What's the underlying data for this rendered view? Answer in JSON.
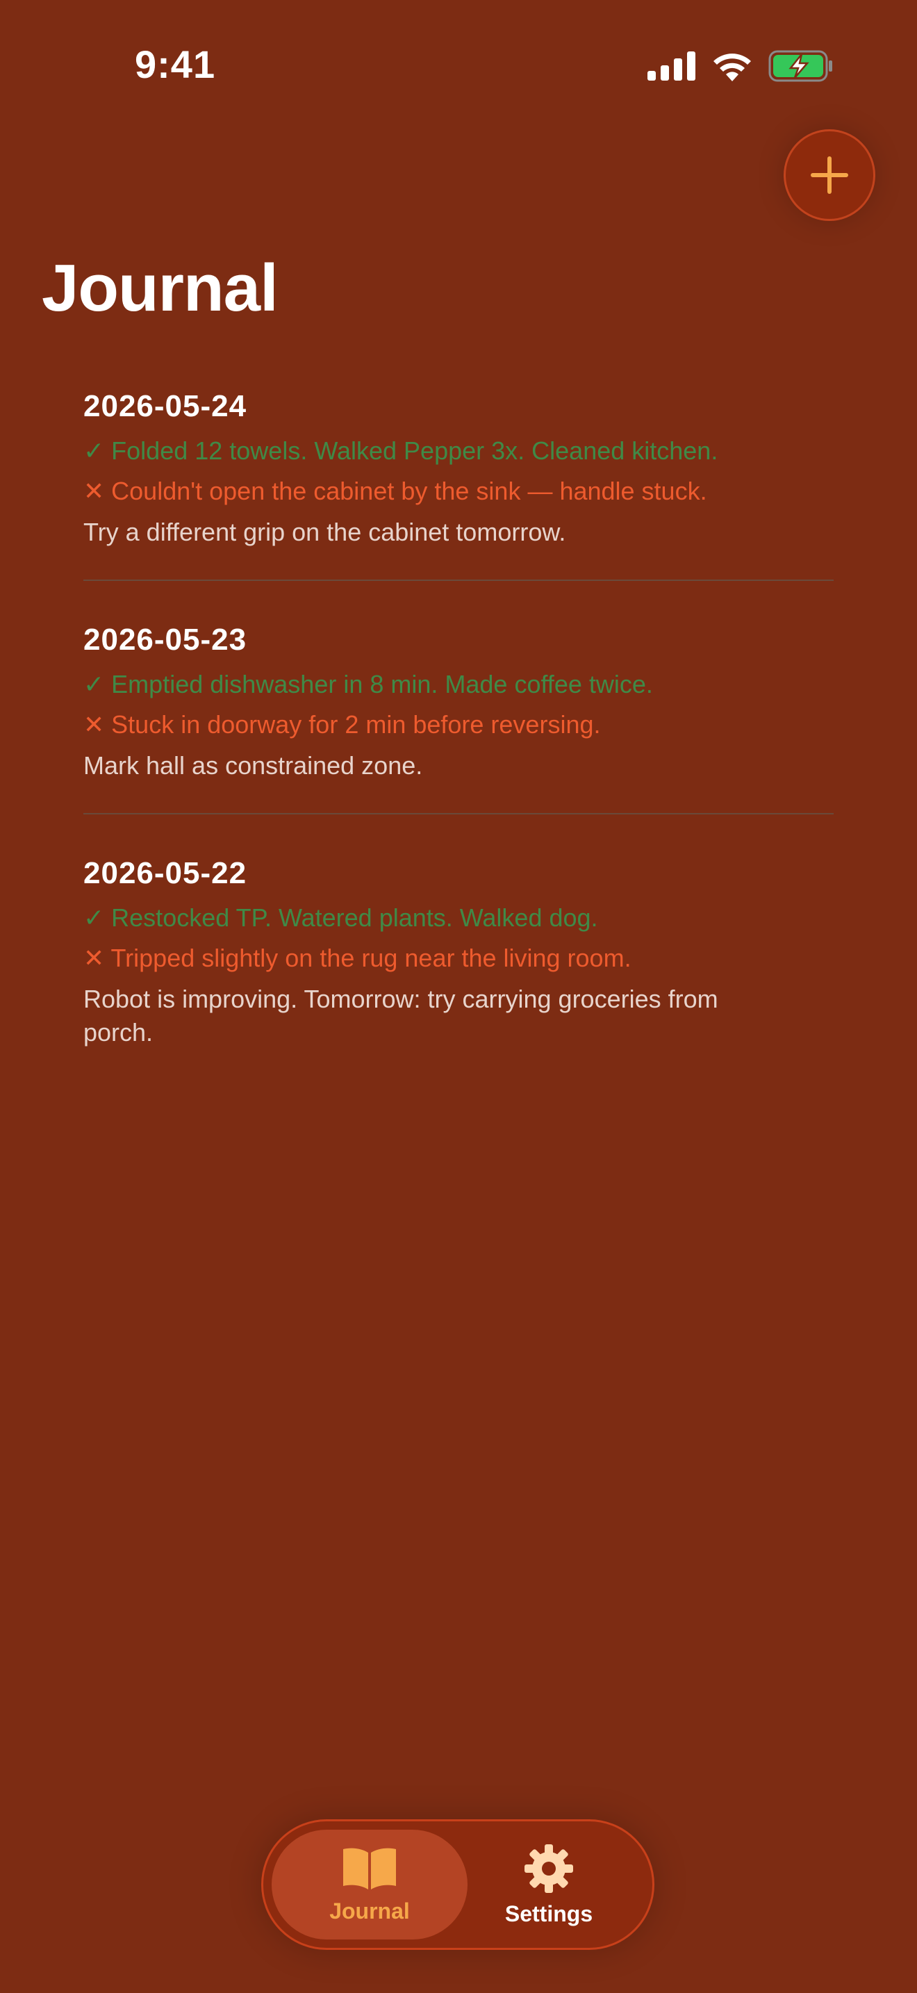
{
  "status_bar": {
    "time": "9:41"
  },
  "header": {
    "title": "Journal",
    "add_icon": "plus-icon"
  },
  "entries": [
    {
      "date": "2026-05-24",
      "success": "✓ Folded 12 towels. Walked Pepper 3x. Cleaned kitchen.",
      "failure": "✕ Couldn't open the cabinet by the sink — handle stuck.",
      "note": "Try a different grip on the cabinet tomorrow."
    },
    {
      "date": "2026-05-23",
      "success": "✓ Emptied dishwasher in 8 min. Made coffee twice.",
      "failure": "✕ Stuck in doorway for 2 min before reversing.",
      "note": "Mark hall as constrained zone."
    },
    {
      "date": "2026-05-22",
      "success": "✓ Restocked TP. Watered plants. Walked dog.",
      "failure": "✕ Tripped slightly on the rug near the living room.",
      "note": "Robot is improving. Tomorrow: try carrying groceries from porch."
    }
  ],
  "tab_bar": {
    "tabs": [
      {
        "label": "Journal",
        "icon": "book-icon",
        "selected": true
      },
      {
        "label": "Settings",
        "icon": "gear-icon",
        "selected": false
      }
    ]
  },
  "colors": {
    "background": "#7d2c13",
    "success": "#3f8a47",
    "failure": "#ee5b2e",
    "accent": "#f6a84a"
  }
}
